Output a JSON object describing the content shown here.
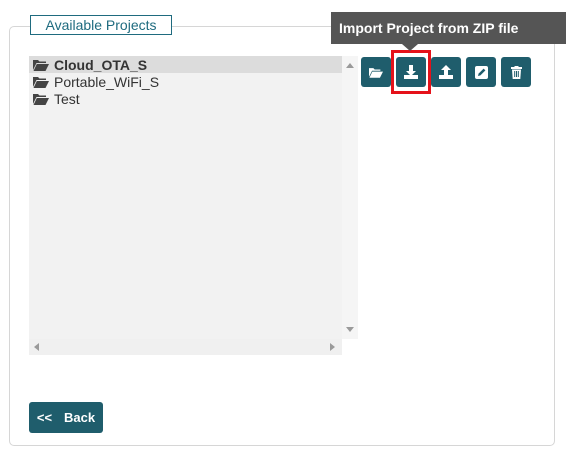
{
  "panel": {
    "legend": "Available Projects"
  },
  "projects": [
    {
      "name": "Cloud_OTA_S",
      "selected": true,
      "icon": "folder-open-icon"
    },
    {
      "name": "Portable_WiFi_S",
      "selected": false,
      "icon": "folder-open-icon"
    },
    {
      "name": "Test",
      "selected": false,
      "icon": "folder-open-icon"
    }
  ],
  "toolbar": {
    "buttons": [
      {
        "icon": "folder-open-icon",
        "action": "open-project"
      },
      {
        "icon": "download-icon",
        "action": "import-zip"
      },
      {
        "icon": "upload-icon",
        "action": "export-zip"
      },
      {
        "icon": "edit-icon",
        "action": "rename-project"
      },
      {
        "icon": "trash-icon",
        "action": "delete-project"
      }
    ]
  },
  "tooltip": {
    "text": "Import Project from ZIP file"
  },
  "back_button": {
    "arrows": "<<",
    "label": "Back"
  },
  "colors": {
    "accent": "#1f5d6c",
    "legend_text": "#1f6b7f",
    "highlight": "#e5121a",
    "tooltip_bg": "#555555"
  }
}
